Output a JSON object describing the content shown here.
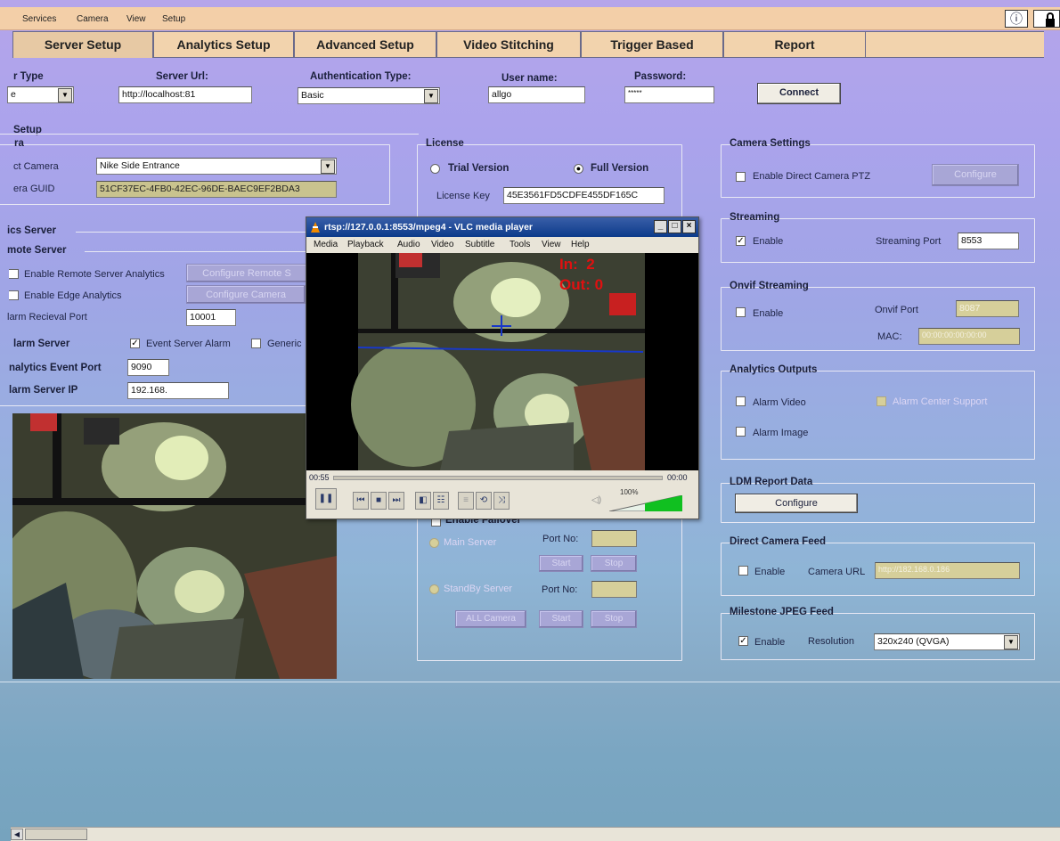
{
  "menu": [
    "Services",
    "Camera",
    "View",
    "Setup"
  ],
  "info_icon": "info-icon",
  "lock_icon": "lock-icon",
  "tabs": [
    "Server Setup",
    "Analytics Setup",
    "Advanced Setup",
    "Video Stitching",
    "Trigger Based",
    "Report"
  ],
  "connection": {
    "server_type_label": "r Type",
    "server_type_value": "e",
    "server_url_label": "Server Url:",
    "server_url_value": "http://localhost:81",
    "auth_label": "Authentication Type:",
    "auth_value": "Basic",
    "user_label": "User name:",
    "user_value": "allgo",
    "password_label": "Password:",
    "password_value": "*****",
    "connect": "Connect"
  },
  "setup_label": "Setup",
  "camera": {
    "group": "ra",
    "select_label": "ct Camera",
    "select_value": "Nike Side Entrance",
    "guid_label": "era GUID",
    "guid_value": "51CF37EC-4FB0-42EC-96DE-BAEC9EF2BDA3"
  },
  "analytics_server": {
    "group": "ics Server",
    "remote_server": "mote Server",
    "enable_remote": "Enable Remote Server Analytics",
    "configure_remote": "Configure Remote S",
    "enable_edge": "Enable Edge Analytics",
    "configure_camera": "Configure Camera",
    "alarm_port_label": "larm Recieval Port",
    "alarm_port_value": "10001",
    "alarm_server": "larm Server",
    "event_server_alarm": "Event Server Alarm",
    "generic": "Generic",
    "event_port_label": "nalytics Event Port",
    "event_port_value": "9090",
    "alarm_ip_label": "larm Server IP",
    "alarm_ip_value": "192.168."
  },
  "license": {
    "group": "License",
    "trial": "Trial Version",
    "full": "Full Version",
    "key_label": "License Key",
    "key_value": "45E3561FD5CDFE455DF165C"
  },
  "failover": {
    "enable": "Enable Failover",
    "main": "Main Server",
    "standby": "StandBy Server",
    "port": "Port No:",
    "start": "Start",
    "stop": "Stop",
    "all_camera": "ALL Camera"
  },
  "camera_settings": {
    "group": "Camera Settings",
    "ptz": "Enable Direct Camera PTZ",
    "configure": "Configure"
  },
  "streaming": {
    "group": "Streaming",
    "enable": "Enable",
    "port_label": "Streaming Port",
    "port_value": "8553"
  },
  "onvif": {
    "group": "Onvif Streaming",
    "enable": "Enable",
    "port_label": "Onvif Port",
    "port_value": "8087",
    "mac_label": "MAC:",
    "mac_value": "00:00:00:00:00:00"
  },
  "analytics_outputs": {
    "group": "Analytics Outputs",
    "alarm_video": "Alarm Video",
    "alarm_center": "Alarm Center Support",
    "alarm_image": "Alarm Image"
  },
  "ldm": {
    "group": "LDM Report Data",
    "configure": "Configure"
  },
  "direct_feed": {
    "group": "Direct Camera Feed",
    "enable": "Enable",
    "url_label": "Camera URL",
    "url_value": "http://182.168.0.186"
  },
  "milestone": {
    "group": "Milestone JPEG Feed",
    "enable": "Enable",
    "res_label": "Resolution",
    "res_value": "320x240 (QVGA)"
  },
  "vlc": {
    "title": "rtsp://127.0.0.1:8553/mpeg4 - VLC media player",
    "menu": [
      "Media",
      "Playback",
      "Audio",
      "Video",
      "Subtitle",
      "Tools",
      "View",
      "Help"
    ],
    "overlay_in": "In:  2",
    "overlay_out": "Out: 0",
    "time_elapsed": "00:55",
    "time_total": "00:00",
    "volume": "100%"
  },
  "colors": {
    "accent": "#f3cfa8",
    "tab": "#f2d3ad",
    "vlc_title": "#0b3a8a",
    "overlay": "#e01010"
  }
}
